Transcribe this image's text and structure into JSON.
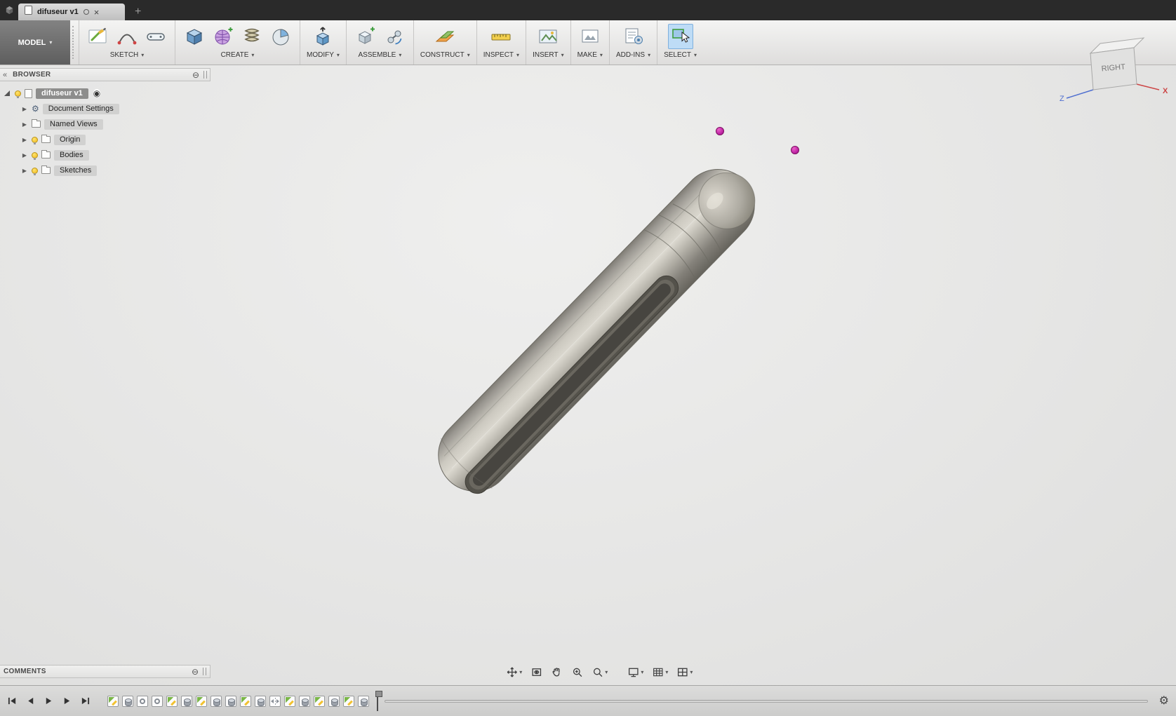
{
  "window": {
    "tab": {
      "title": "difuseur v1"
    }
  },
  "icons": {
    "close": "×",
    "new_tab": "+",
    "caret_down": "▾",
    "collapse_left": "«",
    "minimize": "⊖",
    "radio": "◉",
    "expand": "▶",
    "gear": "⚙"
  },
  "toolbar": {
    "model_menu": {
      "label": "MODEL"
    },
    "groups": [
      {
        "label": "SKETCH"
      },
      {
        "label": "CREATE"
      },
      {
        "label": "MODIFY"
      },
      {
        "label": "ASSEMBLE"
      },
      {
        "label": "CONSTRUCT"
      },
      {
        "label": "INSPECT"
      },
      {
        "label": "INSERT"
      },
      {
        "label": "MAKE"
      },
      {
        "label": "ADD-INS"
      },
      {
        "label": "SELECT"
      }
    ]
  },
  "browser": {
    "title": "BROWSER",
    "root_label": "difuseur v1",
    "items": [
      {
        "label": "Document Settings",
        "icon": "gear-icon"
      },
      {
        "label": "Named Views",
        "icon": "folder-icon"
      },
      {
        "label": "Origin",
        "icon": "folder-icon",
        "bulb": true
      },
      {
        "label": "Bodies",
        "icon": "folder-icon",
        "bulb": true
      },
      {
        "label": "Sketches",
        "icon": "folder-icon",
        "bulb": true
      }
    ]
  },
  "viewcube": {
    "front_face": "RIGHT",
    "axis_x": "X",
    "axis_z": "Z"
  },
  "comments": {
    "title": "COMMENTS"
  },
  "timeline": {
    "features": [
      "sketch",
      "extrude",
      "circle",
      "circle",
      "sketch",
      "extrude",
      "sketch",
      "extrude",
      "extrude",
      "sketch",
      "extrude",
      "mirror",
      "sketch",
      "extrude",
      "sketch",
      "extrude",
      "sketch",
      "extrude"
    ]
  },
  "colors": {
    "select_highlight": "#bedcf6",
    "sketch_point": "#c026a6",
    "axis_x": "#cc4444",
    "axis_z": "#4f6fd0",
    "model_base": "#b5b2a9"
  }
}
